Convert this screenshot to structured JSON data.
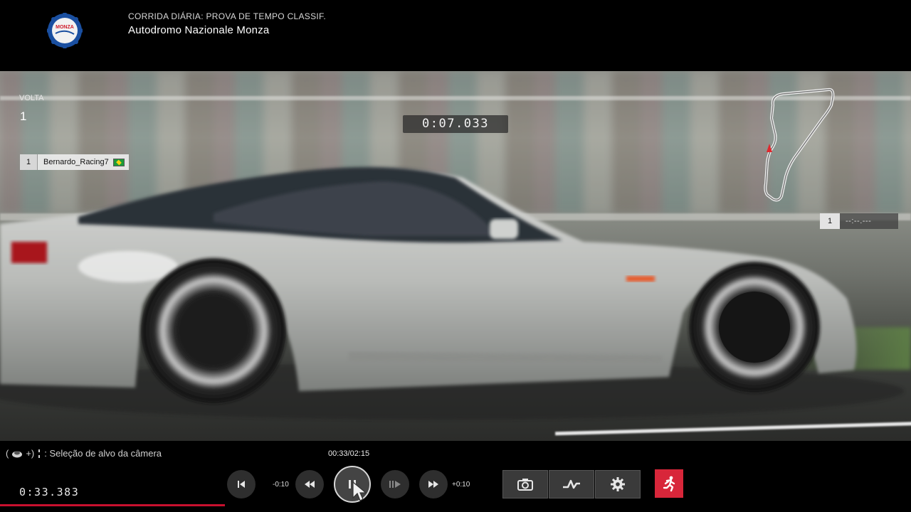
{
  "header": {
    "event_subtitle": "CORRIDA DIÁRIA: PROVA DE TEMPO CLASSIF.",
    "track_name": "Autodromo Nazionale Monza",
    "logo_text": "MONZA"
  },
  "hud": {
    "lap_label": "VOLTA",
    "lap_value": "1",
    "current_time": "0:07.033",
    "driver": {
      "position": "1",
      "name": "Bernardo_Racing7",
      "flag": "brazil-flag-icon"
    },
    "ranking": {
      "position": "1",
      "time": "--:--.---"
    }
  },
  "controls": {
    "camera_hint": ": Seleção de alvo da câmera",
    "camera_hint_icon": "right-stick-icon",
    "playback_position": "00:33/02:15",
    "total_time": "0:33.383",
    "progress_fraction": 0.247,
    "skip_back_label": "-0:10",
    "skip_forward_label": "+0:10",
    "buttons": [
      "skip-to-start",
      "rewind",
      "pause",
      "frame-advance",
      "fast-forward",
      "camera",
      "telemetry",
      "settings",
      "exit"
    ]
  },
  "colors": {
    "accent_red": "#d8263a",
    "progress_red": "#c8102e",
    "map_marker": "#e0282e"
  }
}
